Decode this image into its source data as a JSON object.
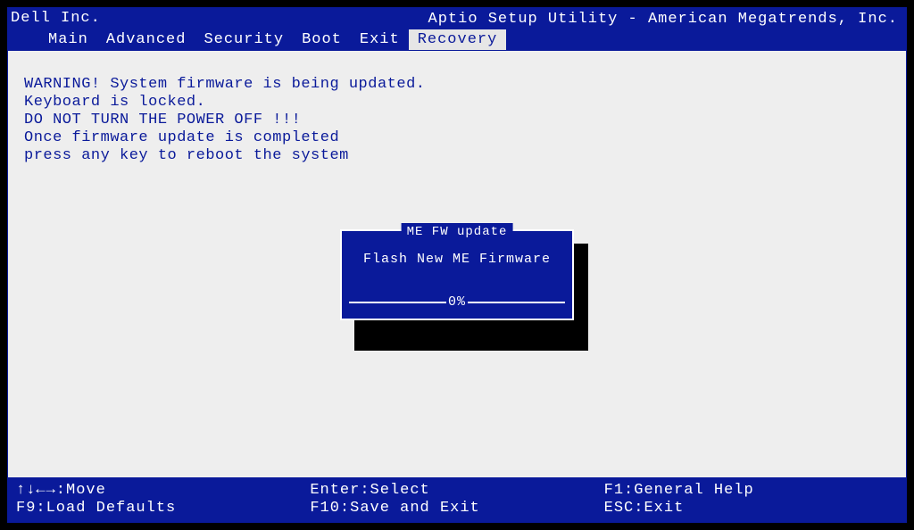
{
  "vendor": "Dell Inc.",
  "utility_title": "Aptio Setup Utility - American Megatrends, Inc.",
  "tabs": [
    {
      "label": "Main",
      "active": false
    },
    {
      "label": "Advanced",
      "active": false
    },
    {
      "label": "Security",
      "active": false
    },
    {
      "label": "Boot",
      "active": false
    },
    {
      "label": "Exit",
      "active": false
    },
    {
      "label": "Recovery",
      "active": true
    }
  ],
  "warning": {
    "line1": "WARNING! System firmware is being updated.",
    "line2": "Keyboard is locked.",
    "line3": "DO NOT TURN THE POWER OFF !!!",
    "line4": "Once firmware update is completed",
    "line5": "press any key to reboot the system"
  },
  "dialog": {
    "title": "ME FW update",
    "body": "Flash New ME Firmware",
    "progress": "0%"
  },
  "footer": {
    "col1": {
      "line1": "↑↓←→:Move",
      "line2": "F9:Load Defaults"
    },
    "col2": {
      "line1": "Enter:Select",
      "line2": "F10:Save and Exit"
    },
    "col3": {
      "line1": "F1:General Help",
      "line2": "ESC:Exit"
    }
  }
}
